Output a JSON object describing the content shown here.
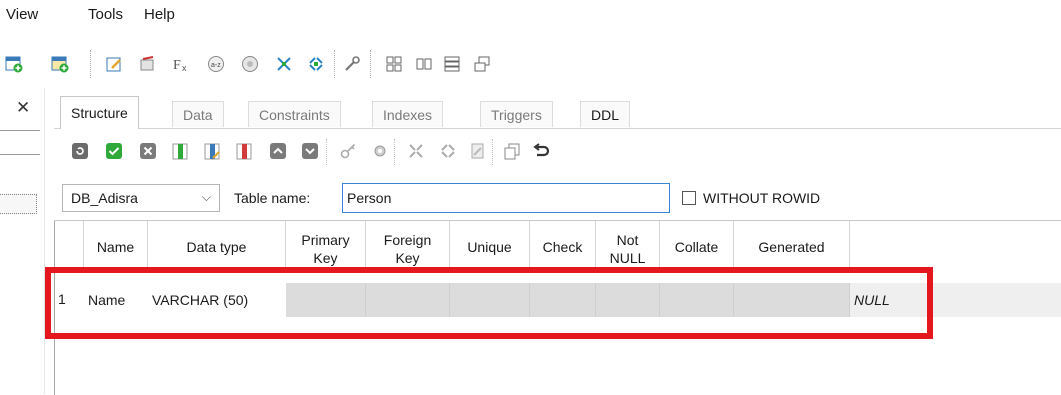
{
  "menu": {
    "view": "View",
    "tools": "Tools",
    "help": "Help"
  },
  "toolbar_icons": [
    "add-table-icon",
    "edit-table-icon",
    "edit-sql-icon",
    "wizard-icon",
    "function-icon",
    "sort-icon",
    "object-icon",
    "split-icon",
    "join-icon",
    "wrench-icon",
    "grid-tile-icon",
    "column-view-icon",
    "row-view-icon",
    "windows-icon"
  ],
  "tabs": [
    {
      "label": "Structure",
      "active": true
    },
    {
      "label": "Data"
    },
    {
      "label": "Constraints"
    },
    {
      "label": "Indexes"
    },
    {
      "label": "Triggers"
    },
    {
      "label": "DDL"
    }
  ],
  "structure_toolbar": [
    "refresh-icon",
    "commit-icon",
    "rollback-icon",
    "add-column-icon",
    "edit-column-icon",
    "delete-column-icon",
    "move-up-icon",
    "move-down-icon",
    "key-icon",
    "gear-icon",
    "split-icon",
    "join-icon",
    "paint-icon",
    "copy-icon",
    "undo-icon"
  ],
  "db_select": {
    "value": "DB_Adisra"
  },
  "table_name": {
    "label": "Table name:",
    "value": "Person"
  },
  "without_rowid": {
    "label": "WITHOUT ROWID",
    "checked": false
  },
  "columns": {
    "name": "Name",
    "data_type": "Data type",
    "primary_key": [
      "Primary",
      "Key"
    ],
    "foreign_key": [
      "Foreign",
      "Key"
    ],
    "unique": "Unique",
    "check": "Check",
    "not_null": [
      "Not",
      "NULL"
    ],
    "collate": "Collate",
    "generated": "Generated"
  },
  "rows": [
    {
      "num": "1",
      "name": "Name",
      "data_type": "VARCHAR (50)",
      "default": "NULL"
    }
  ],
  "colors": {
    "highlight_border": "#e4171f",
    "accent_input": "#3a84d6",
    "commit_green": "#2faa3a"
  }
}
